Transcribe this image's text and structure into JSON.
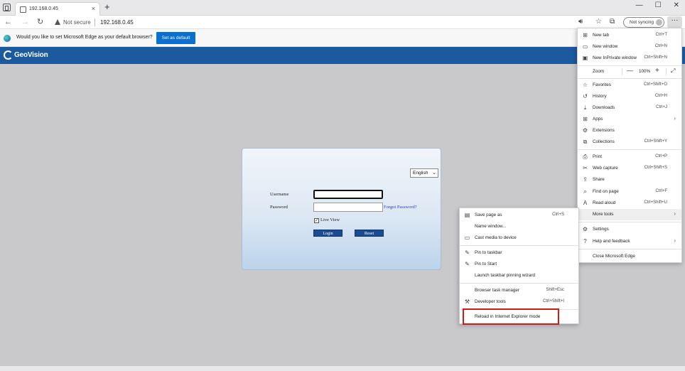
{
  "browser": {
    "tab_title": "192.168.0.45",
    "tab_close": "×",
    "new_tab": "+",
    "win_min": "—",
    "win_max": "☐",
    "win_close": "✕",
    "back": "←",
    "forward": "→",
    "refresh": "↻",
    "security_label": "Not secure",
    "url": "192.168.0.45",
    "not_syncing": "Not syncing",
    "more": "···"
  },
  "banner": {
    "text": "Would you like to set Microsoft Edge as your default browser?",
    "button": "Set as default"
  },
  "app": {
    "logo_text": "GeoVision"
  },
  "login": {
    "language": "English",
    "username_label": "Username",
    "password_label": "Password",
    "username_value": "",
    "password_value": "",
    "forgot_password": "Forgot Password?",
    "live_view_label": "Live View",
    "live_view_checked": "✓",
    "login_button": "Login",
    "reset_button": "Reset"
  },
  "edge_menu": {
    "new_tab": {
      "label": "New tab",
      "shortcut": "Ctrl+T"
    },
    "new_window": {
      "label": "New window",
      "shortcut": "Ctrl+N"
    },
    "new_inprivate": {
      "label": "New InPrivate window",
      "shortcut": "Ctrl+Shift+N"
    },
    "zoom": {
      "label": "Zoom",
      "minus": "—",
      "value": "100%",
      "plus": "+",
      "fullscreen": "⤢"
    },
    "favorites": {
      "label": "Favorites",
      "shortcut": "Ctrl+Shift+O"
    },
    "history": {
      "label": "History",
      "shortcut": "Ctrl+H"
    },
    "downloads": {
      "label": "Downloads",
      "shortcut": "Ctrl+J"
    },
    "apps": {
      "label": "Apps"
    },
    "extensions": {
      "label": "Extensions"
    },
    "collections": {
      "label": "Collections",
      "shortcut": "Ctrl+Shift+Y"
    },
    "print": {
      "label": "Print",
      "shortcut": "Ctrl+P"
    },
    "web_capture": {
      "label": "Web capture",
      "shortcut": "Ctrl+Shift+S"
    },
    "share": {
      "label": "Share"
    },
    "find_on_page": {
      "label": "Find on page",
      "shortcut": "Ctrl+F"
    },
    "read_aloud": {
      "label": "Read aloud",
      "shortcut": "Ctrl+Shift+U"
    },
    "more_tools": {
      "label": "More tools"
    },
    "settings": {
      "label": "Settings"
    },
    "help_feedback": {
      "label": "Help and feedback"
    },
    "close_edge": {
      "label": "Close Microsoft Edge"
    }
  },
  "more_tools_menu": {
    "save_page": {
      "label": "Save page as",
      "shortcut": "Ctrl+S"
    },
    "name_window": {
      "label": "Name window..."
    },
    "cast_media": {
      "label": "Cast media to device"
    },
    "pin_taskbar": {
      "label": "Pin to taskbar"
    },
    "pin_start": {
      "label": "Pin to Start"
    },
    "launch_pinning": {
      "label": "Launch taskbar pinning wizard"
    },
    "task_manager": {
      "label": "Browser task manager",
      "shortcut": "Shift+Esc"
    },
    "dev_tools": {
      "label": "Developer tools",
      "shortcut": "Ctrl+Shift+I"
    },
    "reload_ie": {
      "label": "Reload in Internet Explorer mode"
    }
  },
  "colors": {
    "brand_blue": "#1c5aa0",
    "edge_accent": "#0a6fd1",
    "highlight_red": "#d11a1a"
  },
  "icons": [
    "tab-actions-icon",
    "page-icon",
    "back-icon",
    "forward-icon",
    "refresh-icon",
    "warning-icon",
    "read-aloud-icon",
    "favorites-icon",
    "collections-icon",
    "more-icon",
    "edge-logo-icon",
    "geovision-logo-icon"
  ]
}
